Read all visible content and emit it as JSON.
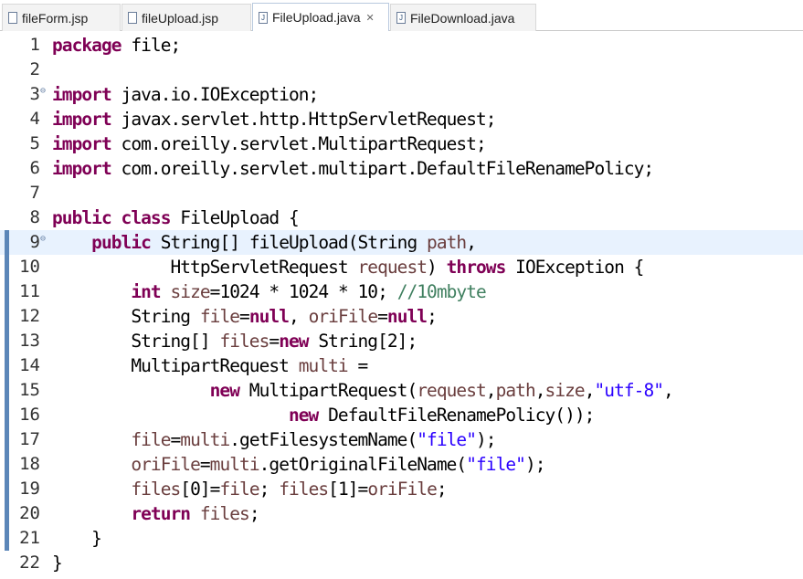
{
  "tabs": [
    {
      "label": "fileForm.jsp",
      "icon": "jsp-file-icon",
      "active": false
    },
    {
      "label": "fileUpload.jsp",
      "icon": "jsp-file-icon",
      "active": false
    },
    {
      "label": "FileUpload.java",
      "icon": "java-file-icon",
      "active": true,
      "close": "✕"
    },
    {
      "label": "FileDownload.java",
      "icon": "java-file-icon",
      "active": false
    }
  ],
  "editor": {
    "colors": {
      "keyword": "#7f0055",
      "variable": "#6a3e3e",
      "string": "#2a00ff",
      "comment": "#3f7f5f",
      "current_line": "#e8f2fe"
    },
    "lines": [
      {
        "n": "1",
        "tokens": [
          {
            "k": "kw",
            "t": "package"
          },
          {
            "t": " file;"
          }
        ]
      },
      {
        "n": "2",
        "tokens": []
      },
      {
        "n": "3",
        "fold": true,
        "tokens": [
          {
            "k": "kw",
            "t": "import"
          },
          {
            "t": " java.io.IOException;"
          }
        ]
      },
      {
        "n": "4",
        "tokens": [
          {
            "k": "kw",
            "t": "import"
          },
          {
            "t": " javax.servlet.http.HttpServletRequest;"
          }
        ]
      },
      {
        "n": "5",
        "tokens": [
          {
            "k": "kw",
            "t": "import"
          },
          {
            "t": " com.oreilly.servlet.MultipartRequest;"
          }
        ]
      },
      {
        "n": "6",
        "tokens": [
          {
            "k": "kw",
            "t": "import"
          },
          {
            "t": " com.oreilly.servlet.multipart.DefaultFileRenamePolicy;"
          }
        ]
      },
      {
        "n": "7",
        "tokens": []
      },
      {
        "n": "8",
        "tokens": [
          {
            "k": "kw",
            "t": "public"
          },
          {
            "t": " "
          },
          {
            "k": "kw",
            "t": "class"
          },
          {
            "t": " FileUpload {"
          }
        ]
      },
      {
        "n": "9",
        "fold": true,
        "current": true,
        "ruler": true,
        "tokens": [
          {
            "t": "    "
          },
          {
            "k": "kw",
            "t": "public"
          },
          {
            "t": " String[] fileUpload(String "
          },
          {
            "k": "var",
            "t": "path"
          },
          {
            "t": ","
          }
        ]
      },
      {
        "n": "10",
        "ruler": true,
        "tokens": [
          {
            "t": "            HttpServletRequest "
          },
          {
            "k": "var",
            "t": "request"
          },
          {
            "t": ") "
          },
          {
            "k": "kw",
            "t": "throws"
          },
          {
            "t": " IOException {"
          }
        ]
      },
      {
        "n": "11",
        "ruler": true,
        "tokens": [
          {
            "t": "        "
          },
          {
            "k": "kw",
            "t": "int"
          },
          {
            "t": " "
          },
          {
            "k": "var",
            "t": "size"
          },
          {
            "t": "=1024 * 1024 * 10; "
          },
          {
            "k": "cm",
            "t": "//10mbyte"
          }
        ]
      },
      {
        "n": "12",
        "ruler": true,
        "tokens": [
          {
            "t": "        String "
          },
          {
            "k": "var",
            "t": "file"
          },
          {
            "t": "="
          },
          {
            "k": "kw",
            "t": "null"
          },
          {
            "t": ", "
          },
          {
            "k": "var",
            "t": "oriFile"
          },
          {
            "t": "="
          },
          {
            "k": "kw",
            "t": "null"
          },
          {
            "t": ";"
          }
        ]
      },
      {
        "n": "13",
        "ruler": true,
        "tokens": [
          {
            "t": "        String[] "
          },
          {
            "k": "var",
            "t": "files"
          },
          {
            "t": "="
          },
          {
            "k": "kw",
            "t": "new"
          },
          {
            "t": " String[2];"
          }
        ]
      },
      {
        "n": "14",
        "ruler": true,
        "tokens": [
          {
            "t": "        MultipartRequest "
          },
          {
            "k": "var",
            "t": "multi"
          },
          {
            "t": " ="
          }
        ]
      },
      {
        "n": "15",
        "ruler": true,
        "tokens": [
          {
            "t": "                "
          },
          {
            "k": "kw",
            "t": "new"
          },
          {
            "t": " MultipartRequest("
          },
          {
            "k": "var",
            "t": "request"
          },
          {
            "t": ","
          },
          {
            "k": "var",
            "t": "path"
          },
          {
            "t": ","
          },
          {
            "k": "var",
            "t": "size"
          },
          {
            "t": ","
          },
          {
            "k": "str",
            "t": "\"utf-8\""
          },
          {
            "t": ","
          }
        ]
      },
      {
        "n": "16",
        "ruler": true,
        "tokens": [
          {
            "t": "                        "
          },
          {
            "k": "kw",
            "t": "new"
          },
          {
            "t": " DefaultFileRenamePolicy());"
          }
        ]
      },
      {
        "n": "17",
        "ruler": true,
        "tokens": [
          {
            "t": "        "
          },
          {
            "k": "var",
            "t": "file"
          },
          {
            "t": "="
          },
          {
            "k": "var",
            "t": "multi"
          },
          {
            "t": ".getFilesystemName("
          },
          {
            "k": "str",
            "t": "\"file\""
          },
          {
            "t": ");"
          }
        ]
      },
      {
        "n": "18",
        "ruler": true,
        "tokens": [
          {
            "t": "        "
          },
          {
            "k": "var",
            "t": "oriFile"
          },
          {
            "t": "="
          },
          {
            "k": "var",
            "t": "multi"
          },
          {
            "t": ".getOriginalFileName("
          },
          {
            "k": "str",
            "t": "\"file\""
          },
          {
            "t": ");"
          }
        ]
      },
      {
        "n": "19",
        "ruler": true,
        "tokens": [
          {
            "t": "        "
          },
          {
            "k": "var",
            "t": "files"
          },
          {
            "t": "[0]="
          },
          {
            "k": "var",
            "t": "file"
          },
          {
            "t": "; "
          },
          {
            "k": "var",
            "t": "files"
          },
          {
            "t": "[1]="
          },
          {
            "k": "var",
            "t": "oriFile"
          },
          {
            "t": ";"
          }
        ]
      },
      {
        "n": "20",
        "ruler": true,
        "tokens": [
          {
            "t": "        "
          },
          {
            "k": "kw",
            "t": "return"
          },
          {
            "t": " "
          },
          {
            "k": "var",
            "t": "files"
          },
          {
            "t": ";"
          }
        ]
      },
      {
        "n": "21",
        "ruler": true,
        "tokens": [
          {
            "t": "    }"
          }
        ]
      },
      {
        "n": "22",
        "tokens": [
          {
            "t": "}"
          }
        ]
      }
    ]
  }
}
